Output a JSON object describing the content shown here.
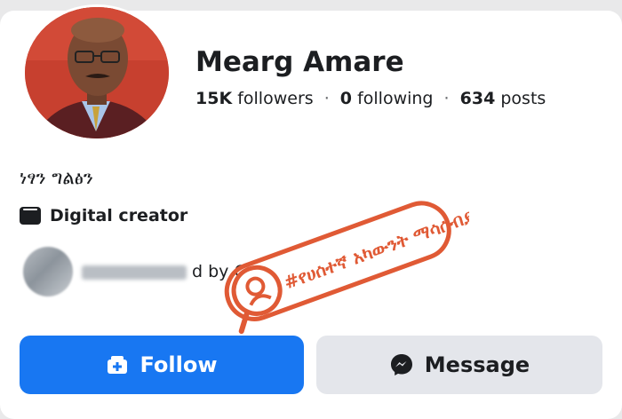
{
  "profile": {
    "name": "Mearg Amare",
    "followers_count": "15K",
    "followers_label": "followers",
    "following_count": "0",
    "following_label": "following",
    "posts_count": "634",
    "posts_label": "posts",
    "separator": "·",
    "bio": "ነፃን ግልፅን",
    "category": "Digital creator",
    "category_icon": "briefcase-icon"
  },
  "mutual": {
    "text_visible": "d by C"
  },
  "stamp": {
    "text": "#የሀሰተኛ አካውንት ማሳሰብያ",
    "color": "#e05a35",
    "icon": "search-person-icon"
  },
  "actions": {
    "follow_label": "Follow",
    "follow_icon": "follow-add-icon",
    "message_label": "Message",
    "message_icon": "messenger-icon"
  },
  "colors": {
    "primary": "#1877f2",
    "secondary_button": "#e4e6eb",
    "text": "#1c1e21"
  }
}
